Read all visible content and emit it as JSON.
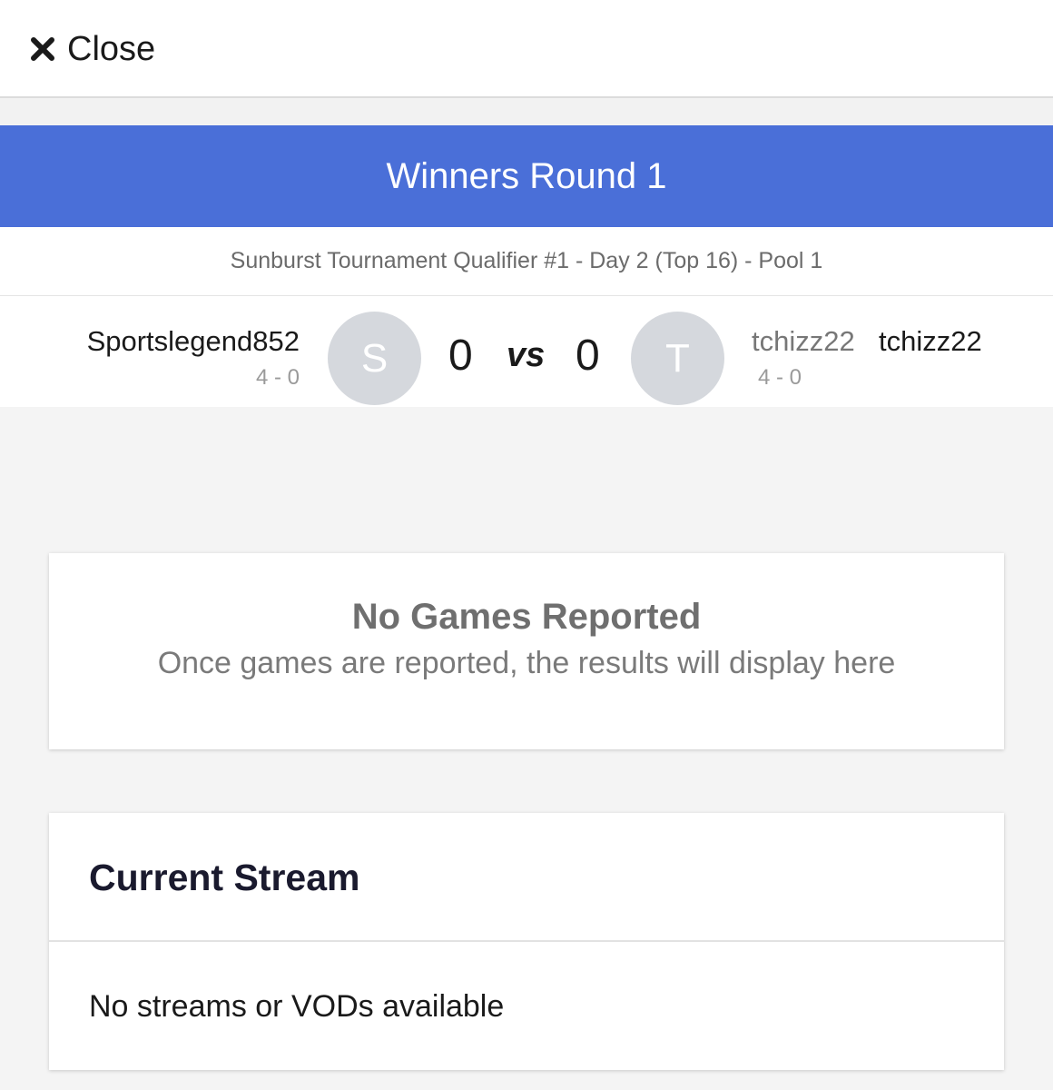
{
  "header": {
    "close_label": "Close",
    "icons": {
      "close": "close-icon"
    }
  },
  "round": {
    "title": "Winners Round 1",
    "banner_color": "#4a6fd8"
  },
  "event": {
    "subtitle": "Sunburst Tournament Qualifier #1 - Day 2 (Top 16) - Pool 1"
  },
  "match": {
    "player1": {
      "name": "Sportslegend852",
      "record": "4 - 0",
      "avatar_initial": "S",
      "score": "0"
    },
    "vs_label": "vs",
    "player2": {
      "tag": "tchizz22",
      "name": "tchizz22",
      "record": "4 - 0",
      "avatar_initial": "T",
      "score": "0"
    }
  },
  "games": {
    "title": "No Games Reported",
    "message": "Once games are reported, the results will display here"
  },
  "stream": {
    "title": "Current Stream",
    "empty_message": "No streams or VODs available"
  }
}
